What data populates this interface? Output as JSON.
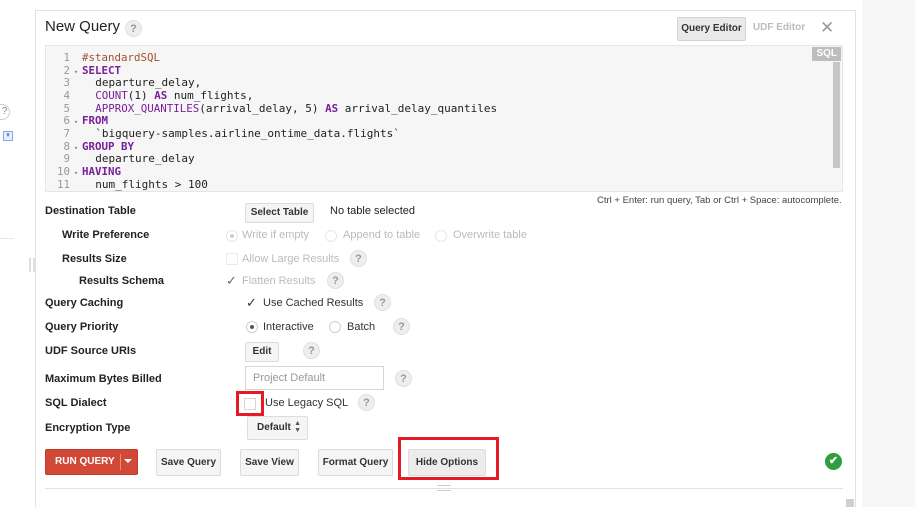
{
  "panel": {
    "title": "New Query",
    "tabs": {
      "query_editor": "Query Editor",
      "udf_editor": "UDF Editor"
    },
    "close_glyph": "✕",
    "help_glyph": "?"
  },
  "editor": {
    "language_badge": "SQL",
    "lines": [
      {
        "num": "1",
        "fold": "",
        "parts": [
          {
            "t": "#standardSQL",
            "c": "cm"
          }
        ]
      },
      {
        "num": "2",
        "fold": "▾",
        "parts": [
          {
            "t": "SELECT",
            "c": "kw"
          }
        ]
      },
      {
        "num": "3",
        "fold": "",
        "parts": [
          {
            "t": "  departure_delay,",
            "c": ""
          }
        ]
      },
      {
        "num": "4",
        "fold": "",
        "parts": [
          {
            "t": "  ",
            "c": ""
          },
          {
            "t": "COUNT",
            "c": "fn"
          },
          {
            "t": "(1) ",
            "c": ""
          },
          {
            "t": "AS",
            "c": "kw"
          },
          {
            "t": " num_flights,",
            "c": ""
          }
        ]
      },
      {
        "num": "5",
        "fold": "",
        "parts": [
          {
            "t": "  ",
            "c": ""
          },
          {
            "t": "APPROX_QUANTILES",
            "c": "fn"
          },
          {
            "t": "(arrival_delay, 5) ",
            "c": ""
          },
          {
            "t": "AS",
            "c": "kw"
          },
          {
            "t": " arrival_delay_quantiles",
            "c": ""
          }
        ]
      },
      {
        "num": "6",
        "fold": "▾",
        "parts": [
          {
            "t": "FROM",
            "c": "kw"
          }
        ]
      },
      {
        "num": "7",
        "fold": "",
        "parts": [
          {
            "t": "  `bigquery-samples.airline_ontime_data.flights`",
            "c": ""
          }
        ]
      },
      {
        "num": "8",
        "fold": "▾",
        "parts": [
          {
            "t": "GROUP BY",
            "c": "kw"
          }
        ]
      },
      {
        "num": "9",
        "fold": "",
        "parts": [
          {
            "t": "  departure_delay",
            "c": ""
          }
        ]
      },
      {
        "num": "10",
        "fold": "▾",
        "parts": [
          {
            "t": "HAVING",
            "c": "kw"
          }
        ]
      },
      {
        "num": "11",
        "fold": "",
        "parts": [
          {
            "t": "  num_flights > 100",
            "c": ""
          }
        ]
      }
    ],
    "shortcut_hint": "Ctrl + Enter: run query, Tab or Ctrl + Space: autocomplete."
  },
  "options": {
    "destination_table": {
      "label": "Destination Table",
      "button": "Select Table",
      "value": "No table selected"
    },
    "write_preference": {
      "label": "Write Preference",
      "options": [
        "Write if empty",
        "Append to table",
        "Overwrite table"
      ],
      "selected": "Write if empty"
    },
    "results_size": {
      "label": "Results Size",
      "option": "Allow Large Results"
    },
    "results_schema": {
      "label": "Results Schema",
      "option": "Flatten Results",
      "checked": true
    },
    "query_caching": {
      "label": "Query Caching",
      "option": "Use Cached Results",
      "checked": true
    },
    "query_priority": {
      "label": "Query Priority",
      "options": [
        "Interactive",
        "Batch"
      ],
      "selected": "Interactive"
    },
    "udf_source_uris": {
      "label": "UDF Source URIs",
      "button": "Edit"
    },
    "maximum_bytes_billed": {
      "label": "Maximum Bytes Billed",
      "placeholder": "Project Default"
    },
    "sql_dialect": {
      "label": "SQL Dialect",
      "option": "Use Legacy SQL",
      "checked": false
    },
    "encryption_type": {
      "label": "Encryption Type",
      "value": "Default"
    }
  },
  "actions": {
    "run_query": "RUN QUERY",
    "save_query": "Save Query",
    "save_view": "Save View",
    "format_query": "Format Query",
    "hide_options": "Hide Options",
    "status_glyph": "✔"
  },
  "colors": {
    "run_button": "#d14836",
    "highlight_box": "#e31b23",
    "status_ok": "#2e9e3f",
    "keyword": "#7a1e99",
    "comment": "#a0522d"
  }
}
